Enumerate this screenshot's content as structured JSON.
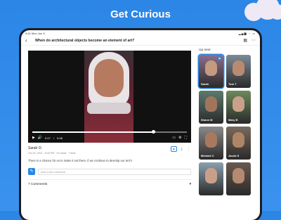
{
  "headline": "Get Curious",
  "status": {
    "time": "9:41 Mon Jun 3",
    "icons": "▂▄▆ ◔ ▭"
  },
  "header": {
    "title": "When do architectural objects become an element of art?",
    "back": "‹"
  },
  "video": {
    "elapsed": "0:17",
    "duration": "0:48",
    "progress": 0.78
  },
  "post": {
    "author": "Sarah O.",
    "date": "Oct 16, 2021 · 6:40 PM",
    "views": "23 views",
    "likes": "7 likes",
    "description": "There is a chance for us to make it out there, if we continue to develop our tech!"
  },
  "comment": {
    "placeholder": "Add a new comment..."
  },
  "comments_count": "7 Comments",
  "up_next": {
    "heading": "Up next",
    "items": [
      {
        "name": "Sarah",
        "color": "#8c6f8c",
        "skin": "#c49a80",
        "active": true
      },
      {
        "name": "Tom T",
        "color": "#7d8a98",
        "skin": "#b98a70",
        "active": false
      },
      {
        "name": "Shane M",
        "color": "#5d7a6d",
        "skin": "#a0755c",
        "active": false
      },
      {
        "name": "Mary B",
        "color": "#6d8a5c",
        "skin": "#c9a088",
        "active": false
      },
      {
        "name": "Michael C",
        "color": "#8a8a8a",
        "skin": "#a77a5f",
        "active": false
      },
      {
        "name": "Jacob S",
        "color": "#7a6a5e",
        "skin": "#b08566",
        "active": false
      },
      {
        "name": "",
        "color": "#8aa0b0",
        "skin": "#c8a08a",
        "active": false
      },
      {
        "name": "",
        "color": "#6a5a50",
        "skin": "#b58a70",
        "active": false
      }
    ]
  },
  "colors": {
    "accent": "#2b86e6",
    "background": "#3b92ee"
  }
}
